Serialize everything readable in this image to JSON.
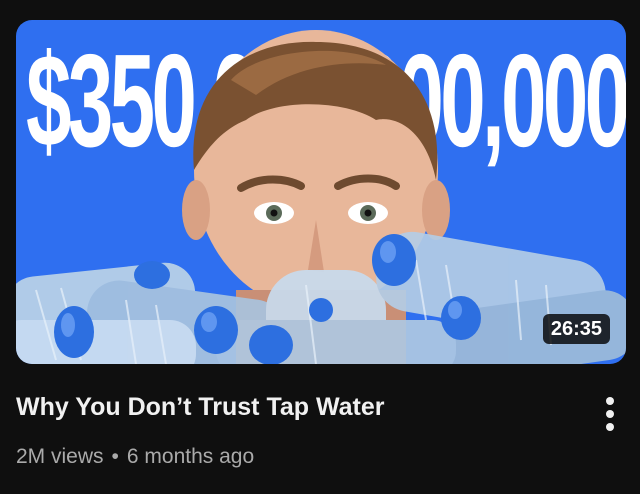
{
  "video": {
    "thumbnail_text": "$350,000,000,000",
    "duration": "26:35",
    "title": "Why You Don’t Trust Tap Water",
    "views": "2M views",
    "separator": "•",
    "age": "6 months ago"
  },
  "icons": {
    "menu": "more-vert-icon"
  },
  "colors": {
    "background": "#0f0f0f",
    "thumbnail_bg": "#2f6ff0",
    "title": "#f1f1f1",
    "meta": "#aaaaaa",
    "bottle_cap": "#2d6fe0"
  }
}
